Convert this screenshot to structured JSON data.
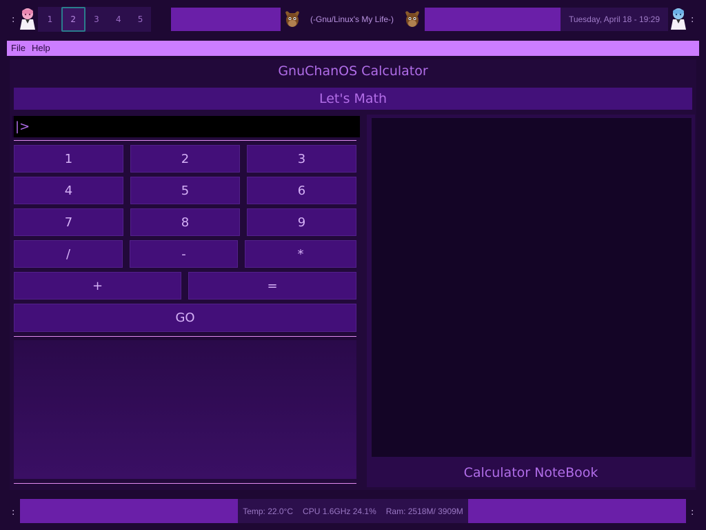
{
  "topbar": {
    "left_sep": ":",
    "right_sep": ":",
    "workspaces": [
      "1",
      "2",
      "3",
      "4",
      "5"
    ],
    "active_workspace": "2",
    "window_title": "(-Gnu/Linux's My Life-)",
    "datetime": "Tuesday, April 18 - 19:29",
    "colors": {
      "bar_block": "#6a1fa8",
      "active_ws_border": "#2a7d8c"
    }
  },
  "menubar": {
    "file": "File",
    "help": "Help"
  },
  "app": {
    "title": "GnuChanOS Calculator",
    "subtitle": "Let's Math",
    "input_prompt": "|>",
    "keypad": {
      "row1": [
        "1",
        "2",
        "3"
      ],
      "row2": [
        "4",
        "5",
        "6"
      ],
      "row3": [
        "7",
        "8",
        "9"
      ],
      "row4": [
        "/",
        "-",
        "*"
      ],
      "row5": [
        "+",
        "="
      ],
      "go": "GO"
    },
    "notebook_label": "Calculator NoteBook",
    "colors": {
      "accent": "#b06de8",
      "menubar": "#cc7dff",
      "button": "#430f79",
      "separator": "#e28cf0"
    }
  },
  "bottombar": {
    "left_sep": ":",
    "right_sep": ":",
    "temp": "Temp: 22.0°C",
    "cpu": "CPU 1.6GHz 24.1%",
    "ram": "Ram:  2518M/ 3909M"
  }
}
